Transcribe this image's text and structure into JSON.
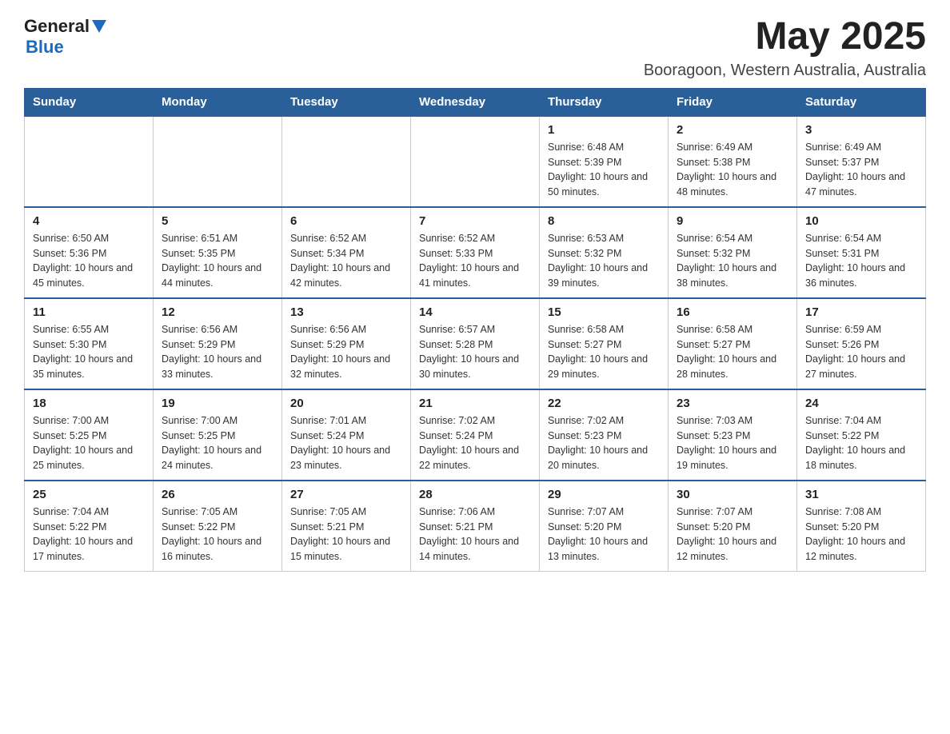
{
  "header": {
    "logo_general": "General",
    "logo_blue": "Blue",
    "month_year": "May 2025",
    "location": "Booragoon, Western Australia, Australia"
  },
  "days_of_week": [
    "Sunday",
    "Monday",
    "Tuesday",
    "Wednesday",
    "Thursday",
    "Friday",
    "Saturday"
  ],
  "weeks": [
    [
      {
        "day": "",
        "sunrise": "",
        "sunset": "",
        "daylight": ""
      },
      {
        "day": "",
        "sunrise": "",
        "sunset": "",
        "daylight": ""
      },
      {
        "day": "",
        "sunrise": "",
        "sunset": "",
        "daylight": ""
      },
      {
        "day": "",
        "sunrise": "",
        "sunset": "",
        "daylight": ""
      },
      {
        "day": "1",
        "sunrise": "Sunrise: 6:48 AM",
        "sunset": "Sunset: 5:39 PM",
        "daylight": "Daylight: 10 hours and 50 minutes."
      },
      {
        "day": "2",
        "sunrise": "Sunrise: 6:49 AM",
        "sunset": "Sunset: 5:38 PM",
        "daylight": "Daylight: 10 hours and 48 minutes."
      },
      {
        "day": "3",
        "sunrise": "Sunrise: 6:49 AM",
        "sunset": "Sunset: 5:37 PM",
        "daylight": "Daylight: 10 hours and 47 minutes."
      }
    ],
    [
      {
        "day": "4",
        "sunrise": "Sunrise: 6:50 AM",
        "sunset": "Sunset: 5:36 PM",
        "daylight": "Daylight: 10 hours and 45 minutes."
      },
      {
        "day": "5",
        "sunrise": "Sunrise: 6:51 AM",
        "sunset": "Sunset: 5:35 PM",
        "daylight": "Daylight: 10 hours and 44 minutes."
      },
      {
        "day": "6",
        "sunrise": "Sunrise: 6:52 AM",
        "sunset": "Sunset: 5:34 PM",
        "daylight": "Daylight: 10 hours and 42 minutes."
      },
      {
        "day": "7",
        "sunrise": "Sunrise: 6:52 AM",
        "sunset": "Sunset: 5:33 PM",
        "daylight": "Daylight: 10 hours and 41 minutes."
      },
      {
        "day": "8",
        "sunrise": "Sunrise: 6:53 AM",
        "sunset": "Sunset: 5:32 PM",
        "daylight": "Daylight: 10 hours and 39 minutes."
      },
      {
        "day": "9",
        "sunrise": "Sunrise: 6:54 AM",
        "sunset": "Sunset: 5:32 PM",
        "daylight": "Daylight: 10 hours and 38 minutes."
      },
      {
        "day": "10",
        "sunrise": "Sunrise: 6:54 AM",
        "sunset": "Sunset: 5:31 PM",
        "daylight": "Daylight: 10 hours and 36 minutes."
      }
    ],
    [
      {
        "day": "11",
        "sunrise": "Sunrise: 6:55 AM",
        "sunset": "Sunset: 5:30 PM",
        "daylight": "Daylight: 10 hours and 35 minutes."
      },
      {
        "day": "12",
        "sunrise": "Sunrise: 6:56 AM",
        "sunset": "Sunset: 5:29 PM",
        "daylight": "Daylight: 10 hours and 33 minutes."
      },
      {
        "day": "13",
        "sunrise": "Sunrise: 6:56 AM",
        "sunset": "Sunset: 5:29 PM",
        "daylight": "Daylight: 10 hours and 32 minutes."
      },
      {
        "day": "14",
        "sunrise": "Sunrise: 6:57 AM",
        "sunset": "Sunset: 5:28 PM",
        "daylight": "Daylight: 10 hours and 30 minutes."
      },
      {
        "day": "15",
        "sunrise": "Sunrise: 6:58 AM",
        "sunset": "Sunset: 5:27 PM",
        "daylight": "Daylight: 10 hours and 29 minutes."
      },
      {
        "day": "16",
        "sunrise": "Sunrise: 6:58 AM",
        "sunset": "Sunset: 5:27 PM",
        "daylight": "Daylight: 10 hours and 28 minutes."
      },
      {
        "day": "17",
        "sunrise": "Sunrise: 6:59 AM",
        "sunset": "Sunset: 5:26 PM",
        "daylight": "Daylight: 10 hours and 27 minutes."
      }
    ],
    [
      {
        "day": "18",
        "sunrise": "Sunrise: 7:00 AM",
        "sunset": "Sunset: 5:25 PM",
        "daylight": "Daylight: 10 hours and 25 minutes."
      },
      {
        "day": "19",
        "sunrise": "Sunrise: 7:00 AM",
        "sunset": "Sunset: 5:25 PM",
        "daylight": "Daylight: 10 hours and 24 minutes."
      },
      {
        "day": "20",
        "sunrise": "Sunrise: 7:01 AM",
        "sunset": "Sunset: 5:24 PM",
        "daylight": "Daylight: 10 hours and 23 minutes."
      },
      {
        "day": "21",
        "sunrise": "Sunrise: 7:02 AM",
        "sunset": "Sunset: 5:24 PM",
        "daylight": "Daylight: 10 hours and 22 minutes."
      },
      {
        "day": "22",
        "sunrise": "Sunrise: 7:02 AM",
        "sunset": "Sunset: 5:23 PM",
        "daylight": "Daylight: 10 hours and 20 minutes."
      },
      {
        "day": "23",
        "sunrise": "Sunrise: 7:03 AM",
        "sunset": "Sunset: 5:23 PM",
        "daylight": "Daylight: 10 hours and 19 minutes."
      },
      {
        "day": "24",
        "sunrise": "Sunrise: 7:04 AM",
        "sunset": "Sunset: 5:22 PM",
        "daylight": "Daylight: 10 hours and 18 minutes."
      }
    ],
    [
      {
        "day": "25",
        "sunrise": "Sunrise: 7:04 AM",
        "sunset": "Sunset: 5:22 PM",
        "daylight": "Daylight: 10 hours and 17 minutes."
      },
      {
        "day": "26",
        "sunrise": "Sunrise: 7:05 AM",
        "sunset": "Sunset: 5:22 PM",
        "daylight": "Daylight: 10 hours and 16 minutes."
      },
      {
        "day": "27",
        "sunrise": "Sunrise: 7:05 AM",
        "sunset": "Sunset: 5:21 PM",
        "daylight": "Daylight: 10 hours and 15 minutes."
      },
      {
        "day": "28",
        "sunrise": "Sunrise: 7:06 AM",
        "sunset": "Sunset: 5:21 PM",
        "daylight": "Daylight: 10 hours and 14 minutes."
      },
      {
        "day": "29",
        "sunrise": "Sunrise: 7:07 AM",
        "sunset": "Sunset: 5:20 PM",
        "daylight": "Daylight: 10 hours and 13 minutes."
      },
      {
        "day": "30",
        "sunrise": "Sunrise: 7:07 AM",
        "sunset": "Sunset: 5:20 PM",
        "daylight": "Daylight: 10 hours and 12 minutes."
      },
      {
        "day": "31",
        "sunrise": "Sunrise: 7:08 AM",
        "sunset": "Sunset: 5:20 PM",
        "daylight": "Daylight: 10 hours and 12 minutes."
      }
    ]
  ]
}
